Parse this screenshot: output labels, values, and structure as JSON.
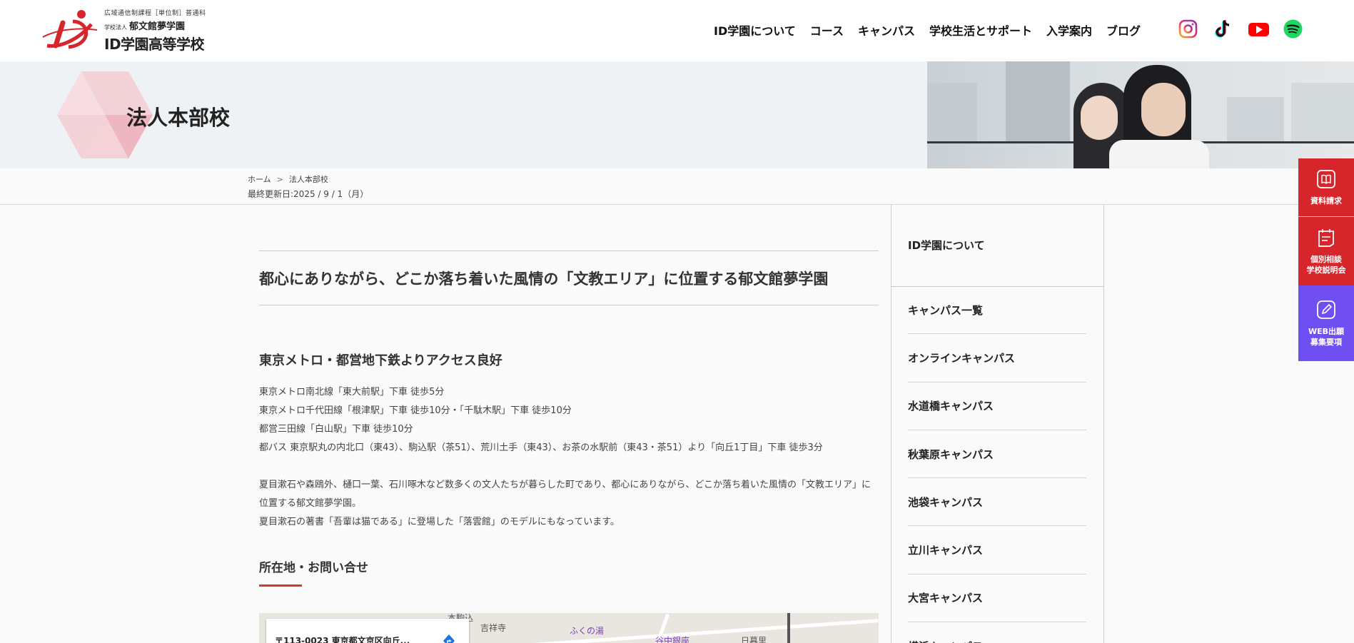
{
  "header": {
    "logo": {
      "sub1": "広域通信制課程［単位制］普通科",
      "corp": "学校法人",
      "school_corp": "郁文館夢学園",
      "name": "ID学園高等学校"
    },
    "nav": [
      "ID学園について",
      "コース",
      "キャンパス",
      "学校生活とサポート",
      "入学案内",
      "ブログ"
    ],
    "sns": [
      "instagram-icon",
      "tiktok-icon",
      "youtube-icon",
      "spotify-icon"
    ],
    "colors": {
      "brand_red": "#d6262b",
      "purple": "#6f4ef2"
    }
  },
  "hero": {
    "title": "法人本部校"
  },
  "breadcrumb": {
    "home": "ホーム",
    "sep": ">",
    "current": "法人本部校"
  },
  "updated": "最終更新日:2025 / 9 / 1（月）",
  "main": {
    "lead": "都心にありながら、どこか落ち着いた風情の「文教エリア」に位置する郁文館夢学園",
    "access_heading": "東京メトロ・都営地下鉄よりアクセス良好",
    "access": [
      "東京メトロ南北線「東大前駅」下車 徒歩5分",
      "東京メトロ千代田線「根津駅」下車 徒歩10分・「千駄木駅」下車 徒歩10分",
      "都営三田線「白山駅」下車 徒歩10分",
      "都バス 東京駅丸の内北口（東43）、駒込駅（茶51）、荒川土手（東43）、お茶の水駅前（東43・茶51）より「向丘1丁目」下車 徒歩3分"
    ],
    "description": [
      "夏目漱石や森鴎外、樋口一葉、石川啄木など数多くの文人たちが暮らした町であり、都心にありながら、どこか落ち着いた風情の「文教エリア」に位置する郁文館夢学園。",
      "夏目漱石の著書「吾輩は猫である」に登場した「落雲館」のモデルにもなっています。"
    ],
    "location_heading": "所在地・お問い合せ",
    "map": {
      "address": "〒113-0023 東京都文京区向丘...",
      "labels": [
        "本駒込",
        "吉祥寺",
        "ふくの湯",
        "谷中銀座",
        "日暮里"
      ]
    }
  },
  "sidebar": {
    "title": "ID学園について",
    "items": [
      "キャンパス一覧",
      "オンラインキャンパス",
      "水道橋キャンパス",
      "秋葉原キャンパス",
      "池袋キャンパス",
      "立川キャンパス",
      "大宮キャンパス",
      "横浜キャンパス"
    ]
  },
  "tabs": {
    "request": "資料請求",
    "consult_1": "個別相談",
    "consult_2": "学校説明会",
    "web_1": "WEB出願",
    "web_2": "募集要項"
  }
}
